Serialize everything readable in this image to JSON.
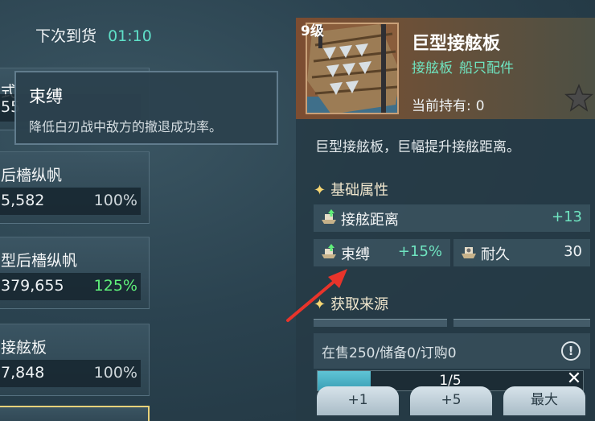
{
  "restock": {
    "label": "下次到货",
    "time": "01:10"
  },
  "list": [
    {
      "name": "式",
      "price": "55",
      "pct": ""
    },
    {
      "name": "后檣纵帆",
      "price": "5,582",
      "pct": "100%",
      "pct_color": "normal"
    },
    {
      "name": "型后檣纵帆",
      "price": "379,655",
      "pct": "125%",
      "pct_color": "green"
    },
    {
      "name": "接舷板",
      "price": "7,848",
      "pct": "100%",
      "pct_color": "normal"
    }
  ],
  "tooltip": {
    "title": "束缚",
    "desc": "降低白刃战中敌方的撤退成功率。"
  },
  "item": {
    "level": "9级",
    "name": "巨型接舷板",
    "tags": [
      "接舷板",
      "船只配件"
    ],
    "holding_label": "当前持有:",
    "holding_value": "0",
    "description": "巨型接舷板，巨幅提升接舷距离。"
  },
  "sections": {
    "base_attrs": "基础属性",
    "source": "获取来源"
  },
  "attributes": [
    {
      "label": "接舷距离",
      "value": "+13"
    },
    {
      "label": "束缚",
      "value": "+15%"
    },
    {
      "label": "耐久",
      "value": "30"
    }
  ],
  "stock": {
    "text": "在售250/储备0/订购0",
    "info_icon": "!"
  },
  "quantity": {
    "text": "1/5",
    "fraction": 0.2,
    "clear_icon": "✕"
  },
  "buttons": [
    "+1",
    "+5",
    "最大"
  ],
  "colors": {
    "accent_teal": "#6fe4c0",
    "green": "#5ff07a",
    "header_brown": "#7d4d31"
  }
}
